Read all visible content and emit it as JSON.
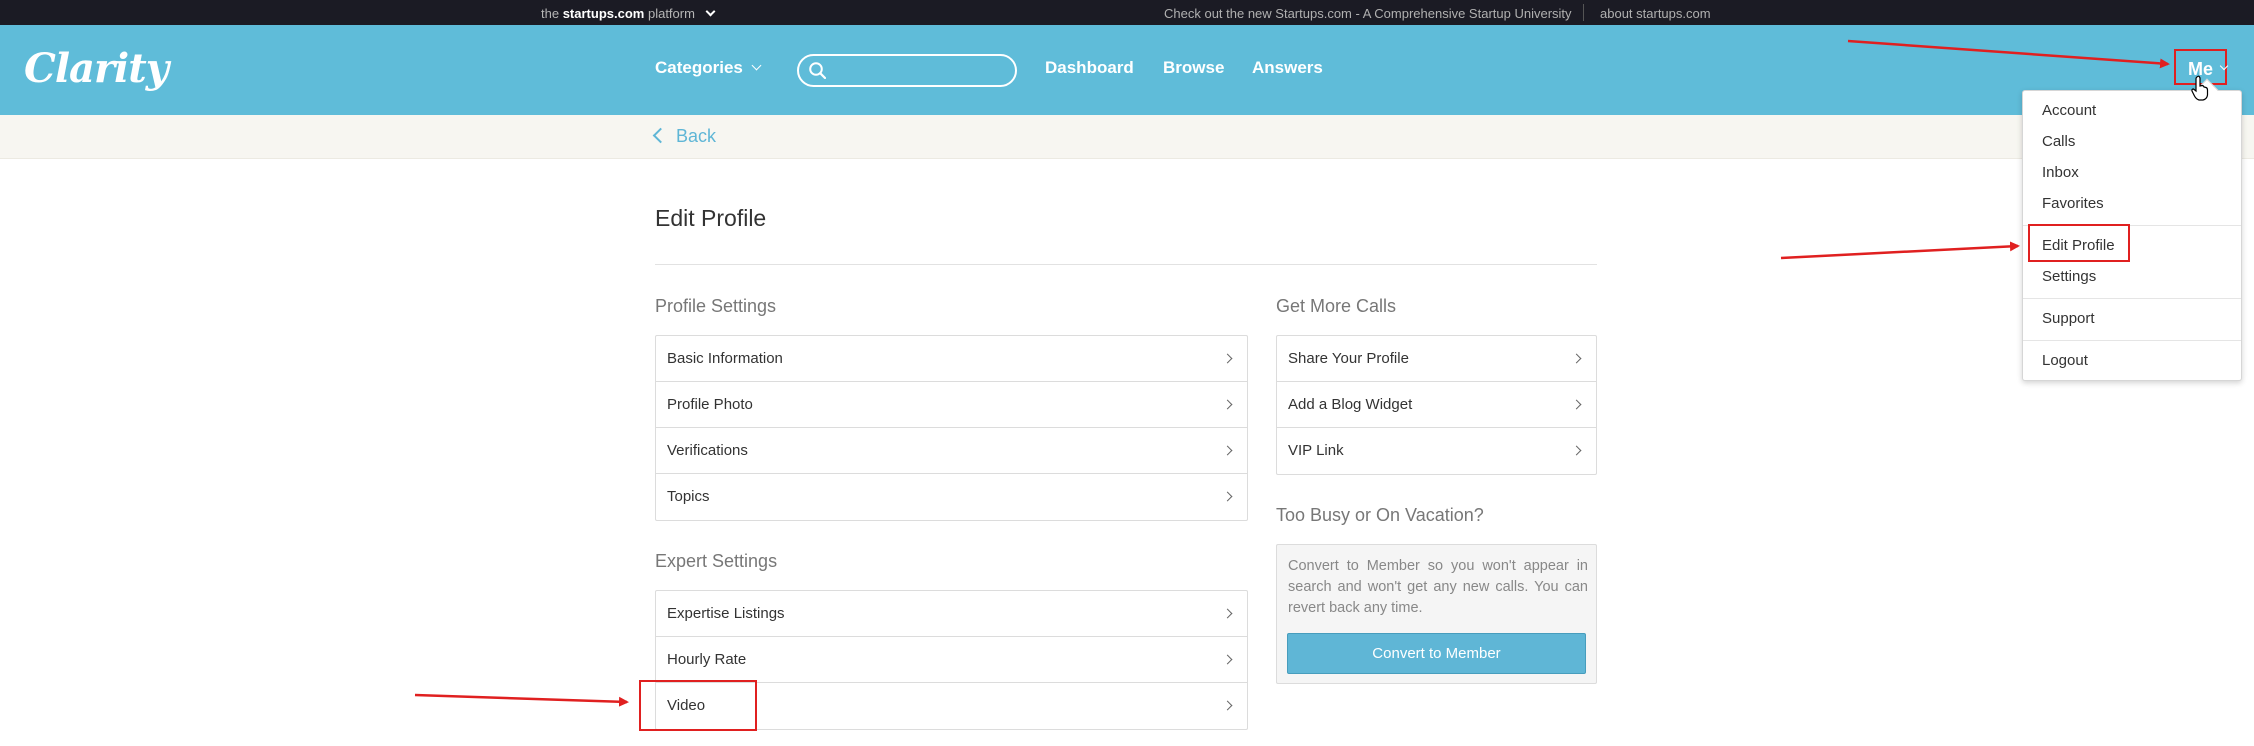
{
  "topbar": {
    "brand_prefix": "the",
    "brand_name": "startups.com",
    "brand_suffix": "platform",
    "promo": "Check out the new Startups.com - A Comprehensive Startup University",
    "about": "about startups.com"
  },
  "header": {
    "logo": "Clarity",
    "categories": "Categories",
    "search_placeholder": "",
    "nav": [
      "Dashboard",
      "Browse",
      "Answers"
    ],
    "me": "Me"
  },
  "subbar": {
    "back": "Back"
  },
  "main": {
    "title": "Edit Profile",
    "profile_settings": {
      "title": "Profile Settings",
      "items": [
        "Basic Information",
        "Profile Photo",
        "Verifications",
        "Topics"
      ]
    },
    "expert_settings": {
      "title": "Expert Settings",
      "items": [
        "Expertise Listings",
        "Hourly Rate",
        "Video"
      ]
    },
    "get_more_calls": {
      "title": "Get More Calls",
      "items": [
        "Share Your Profile",
        "Add a Blog Widget",
        "VIP Link"
      ]
    },
    "vacation": {
      "title": "Too Busy or On Vacation?",
      "text": "Convert to Member so you won't appear in search and won't get any new calls. You can revert back any time.",
      "button": "Convert to Member"
    }
  },
  "dropdown": {
    "items": [
      "Account",
      "Calls",
      "Inbox",
      "Favorites",
      "Edit Profile",
      "Settings",
      "Support",
      "Logout"
    ]
  },
  "colors": {
    "header_bg": "#5fbcd9",
    "topbar_bg": "#1b1b24",
    "accent": "#5fb6d6",
    "annotation": "#e02020"
  }
}
